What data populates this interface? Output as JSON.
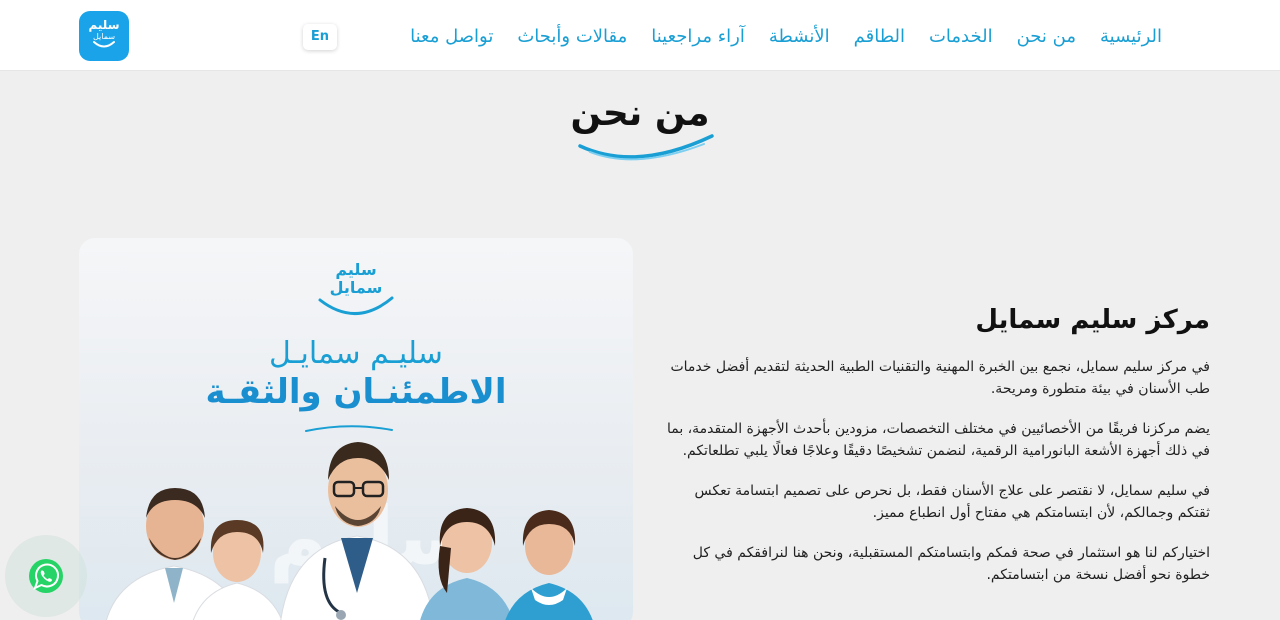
{
  "logo": {
    "line1": "سليم",
    "line2": "سمايل"
  },
  "nav": {
    "items": [
      "الرئيسية",
      "من نحن",
      "الخدمات",
      "الطاقم",
      "الأنشطة",
      "آراء مراجعينا",
      "مقالات وأبحاث",
      "تواصل معنا"
    ],
    "lang_label": "En"
  },
  "page_title": "من نحن",
  "card": {
    "logo_line1": "سليم",
    "logo_line2": "سمايل",
    "headline1": "سليـم سمايـل",
    "headline2": "الاطمئنـان والثقـة",
    "watermark": "سليم"
  },
  "content": {
    "heading": "مركز سليم سمايل",
    "p1": "في مركز سليم سمايل، نجمع بين الخبرة المهنية والتقنيات الطبية الحديثة لتقديم أفضل خدمات طب الأسنان في بيئة متطورة ومريحة.",
    "p2": "يضم مركزنا فريقًا من الأخصائيين في مختلف التخصصات، مزودين بأحدث الأجهزة المتقدمة، بما في ذلك أجهزة الأشعة البانورامية الرقمية، لنضمن تشخيصًا دقيقًا وعلاجًا فعالًا يلبي تطلعاتكم.",
    "p3": "في سليم سمايل، لا نقتصر على علاج الأسنان فقط، بل نحرص على تصميم ابتسامة تعكس ثقتكم وجمالكم، لأن ابتسامتكم هي مفتاح أول انطباع مميز.",
    "p4": "اختياركم لنا هو استثمار في صحة فمكم وابتسامتكم المستقبلية، ونحن هنا لنرافقكم في كل خطوة نحو أفضل نسخة من ابتسامتكم."
  },
  "colors": {
    "brand": "#1aa3e8",
    "nav_text": "#1a9fd4",
    "whatsapp": "#25d366"
  },
  "icons": {
    "whatsapp": "whatsapp-icon"
  }
}
